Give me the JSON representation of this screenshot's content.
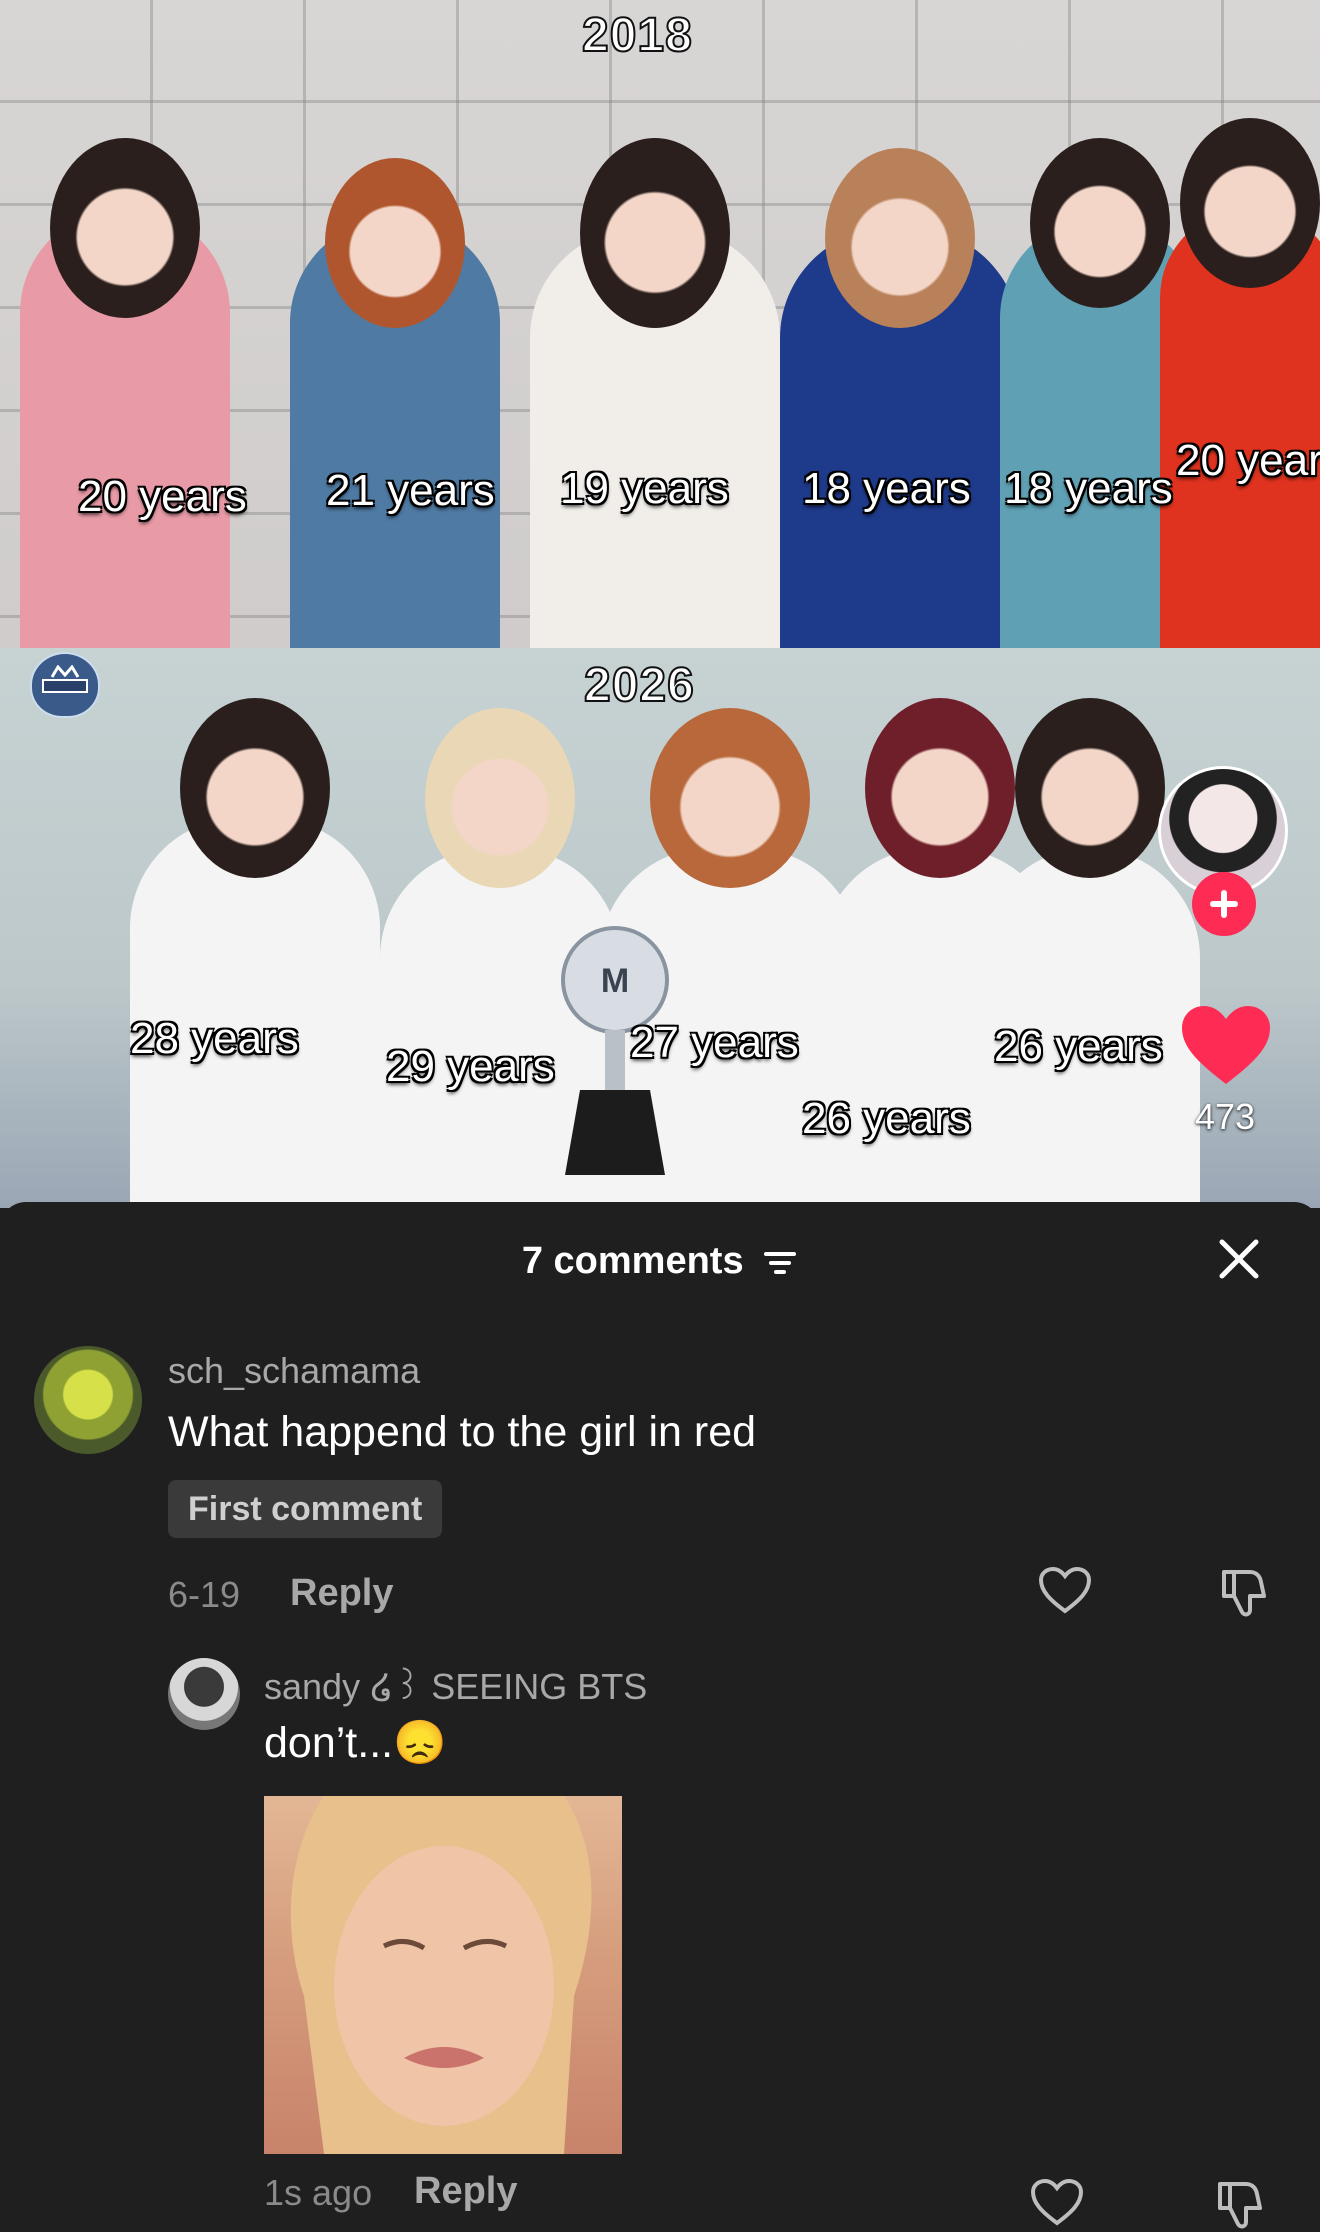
{
  "video": {
    "top_photo": {
      "year": "2018",
      "ages": [
        "20 years",
        "21 years",
        "19 years",
        "18 years",
        "18 years",
        "20 year"
      ]
    },
    "bottom_photo": {
      "year": "2026",
      "ages": [
        "28 years",
        "29 years",
        "27 years",
        "26 years",
        "26 years"
      ]
    },
    "like_count": "473"
  },
  "comments_panel": {
    "header": "7 comments",
    "comments": [
      {
        "username": "sch_schamama",
        "text": "What happend to the girl in red",
        "badge": "First comment",
        "date": "6-19",
        "reply_label": "Reply",
        "reply": {
          "username": "sandy ໒꒱ SEEING BTS",
          "text": "don’t...😞",
          "date": "1s ago",
          "reply_label": "Reply"
        }
      }
    ]
  },
  "icons": [
    "logo-icon",
    "plus-icon",
    "heart-icon",
    "sort-icon",
    "close-icon",
    "heart-outline-icon",
    "dislike-icon"
  ],
  "colors": {
    "accent": "#fe2c55",
    "sheet_bg": "#1f1f1f",
    "muted_text": "#a8a8a8"
  }
}
